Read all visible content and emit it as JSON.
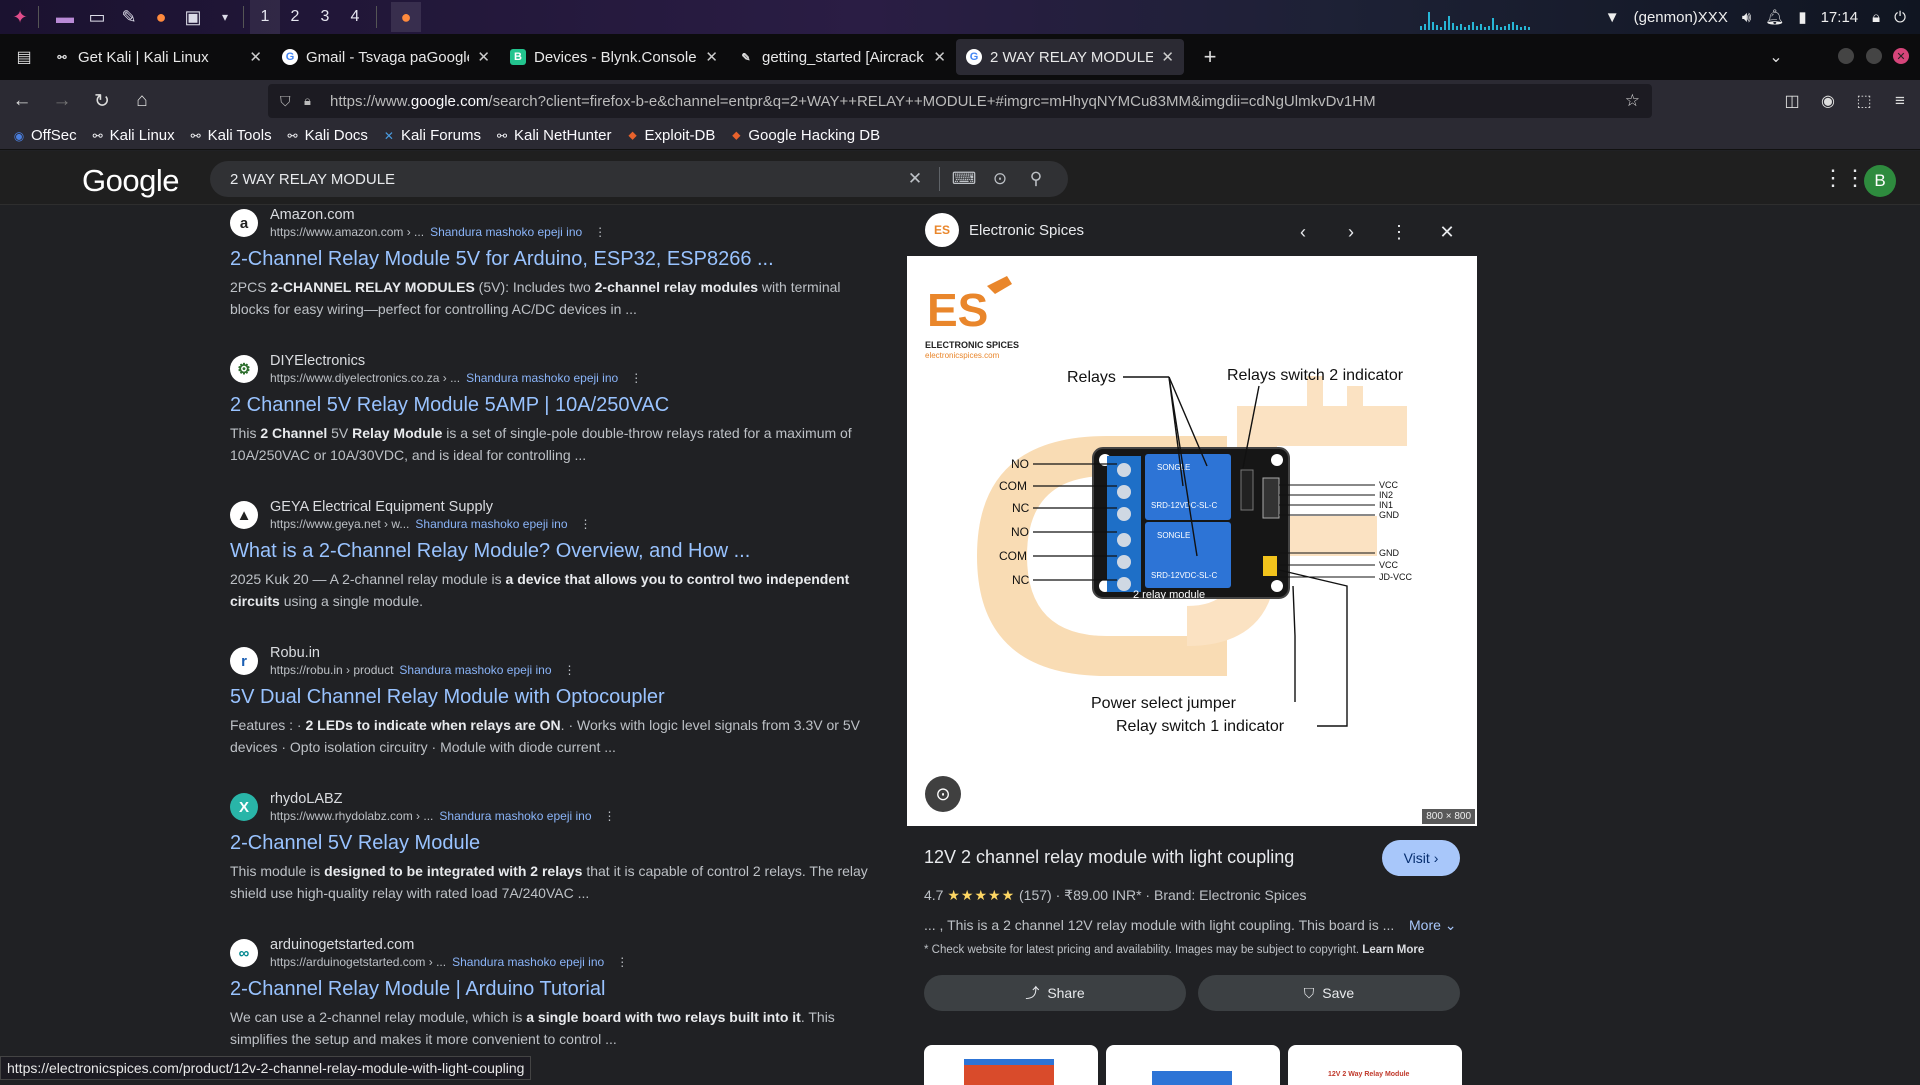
{
  "taskbar": {
    "workspaces": [
      "1",
      "2",
      "3",
      "4"
    ],
    "network_label": "(genmon)XXX",
    "clock": "17:14"
  },
  "browser": {
    "tabs": [
      {
        "title": "Get Kali | Kali Linux",
        "fav": "kali-icon"
      },
      {
        "title": "Gmail - Tsvaga paGoogle",
        "fav": "google-icon"
      },
      {
        "title": "Devices - Blynk.Console",
        "fav": "blynk-icon"
      },
      {
        "title": "getting_started [Aircrack",
        "fav": "doc-icon"
      },
      {
        "title": "2 WAY RELAY MODULE -",
        "fav": "google-icon"
      }
    ],
    "url_prefix": "https://www.",
    "url_domain": "google.com",
    "url_rest": "/search?client=firefox-b-e&channel=entpr&q=2+WAY++RELAY++MODULE+#imgrc=mHhyqNYMCu83MM&imgdii=cdNgUlmkvDv1HM",
    "bookmarks": [
      "OffSec",
      "Kali Linux",
      "Kali Tools",
      "Kali Docs",
      "Kali Forums",
      "Kali NetHunter",
      "Exploit-DB",
      "Google Hacking DB"
    ]
  },
  "google": {
    "logo": "Google",
    "query": "2 WAY RELAY MODULE",
    "avatar_letter": "B"
  },
  "results": [
    {
      "site": "Amazon.com",
      "cite": "https://www.amazon.com › ...",
      "shandura": "Shandura mashoko epeji ino",
      "title": "2-Channel Relay Module 5V for Arduino, ESP32, ESP8266 ...",
      "snippet_parts": [
        "2PCS ",
        "2-CHANNEL RELAY MODULES",
        " (5V): Includes two ",
        "2-channel relay modules",
        " with terminal blocks for easy wiring—perfect for controlling AC/DC devices in ..."
      ],
      "icon": "a"
    },
    {
      "site": "DIYElectronics",
      "cite": "https://www.diyelectronics.co.za › ...",
      "shandura": "Shandura mashoko epeji ino",
      "title": "2 Channel 5V Relay Module 5AMP | 10A/250VAC",
      "snippet_parts": [
        "This ",
        "2 Channel",
        " 5V ",
        "Relay Module",
        " is a set of single-pole double-throw relays rated for a maximum of 10A/250VAC or 10A/30VDC, and is ideal for controlling ..."
      ],
      "icon": "⚙"
    },
    {
      "site": "GEYA Electrical Equipment Supply",
      "cite": "https://www.geya.net › w...",
      "shandura": "Shandura mashoko epeji ino",
      "title": "What is a 2-Channel Relay Module? Overview, and How ...",
      "snippet_parts": [
        "2025 Kuk 20 — A 2-channel relay module is ",
        "a device that allows you to control two independent circuits",
        " using a single module.",
        "",
        ""
      ],
      "icon": "▲"
    },
    {
      "site": "Robu.in",
      "cite": "https://robu.in › product",
      "shandura": "Shandura mashoko epeji ino",
      "title": "5V Dual Channel Relay Module with Optocoupler",
      "snippet_parts": [
        "Features : · ",
        "2 LEDs to indicate when relays are ON",
        ". · Works with logic level signals from 3.3V or 5V devices · Opto isolation circuitry · Module with diode current ...",
        "",
        ""
      ],
      "icon": "r"
    },
    {
      "site": "rhydoLABZ",
      "cite": "https://www.rhydolabz.com › ...",
      "shandura": "Shandura mashoko epeji ino",
      "title": "2-Channel 5V Relay Module",
      "snippet_parts": [
        "This module is ",
        "designed to be integrated with 2 relays",
        " that it is capable of control 2 relays. The relay shield use high-quality relay with rated load 7A/240VAC ...",
        "",
        ""
      ],
      "icon": "X"
    },
    {
      "site": "arduinogetstarted.com",
      "cite": "https://arduinogetstarted.com › ...",
      "shandura": "Shandura mashoko epeji ino",
      "title": "2-Channel Relay Module | Arduino Tutorial",
      "snippet_parts": [
        "We can use a 2-channel relay module, which is ",
        "a single board with two relays built into it",
        ". This simplifies the setup and makes it more convenient to control ...",
        "",
        ""
      ],
      "icon": "∞"
    }
  ],
  "panel": {
    "source": "Electronic Spices",
    "dims": "800 × 800",
    "title": "12V 2 channel relay module with light coupling",
    "visit": "Visit",
    "rating": "4.7",
    "stars": "★★★★★",
    "reviews": "(157)",
    "price": "₹89.00 INR*",
    "brand": "Brand: Electronic Spices",
    "desc": "... , This is a 2 channel 12V relay module with light coupling. This board is ...",
    "more": "More",
    "note": "* Check website for latest pricing and availability. Images may be subject to copyright.",
    "learn_more": "Learn More",
    "share": "Share",
    "save": "Save",
    "image": {
      "brand_logo": "ES",
      "brand_name": "ELECTRONIC SPICES",
      "brand_url": "electronicspices.com",
      "label_relays": "Relays",
      "label_ind2": "Relays switch 2 indicator",
      "left_pins": [
        "NO",
        "COM",
        "NC",
        "NO",
        "COM",
        "NC"
      ],
      "right_pins_top": [
        "VCC",
        "IN2",
        "IN1",
        "GND"
      ],
      "right_pins_bot": [
        "GND",
        "VCC",
        "JD-VCC"
      ],
      "relay_brand": "SONGLE",
      "relay_model": "SRD-12VDC-SL-C",
      "board_label": "2 relay module",
      "label_jumper": "Power select jumper",
      "label_ind1": "Relay switch 1 indicator"
    },
    "thumb3_caption": "12V 2 Way Relay Module"
  },
  "status_url": "https://electronicspices.com/product/12v-2-channel-relay-module-with-light-coupling"
}
